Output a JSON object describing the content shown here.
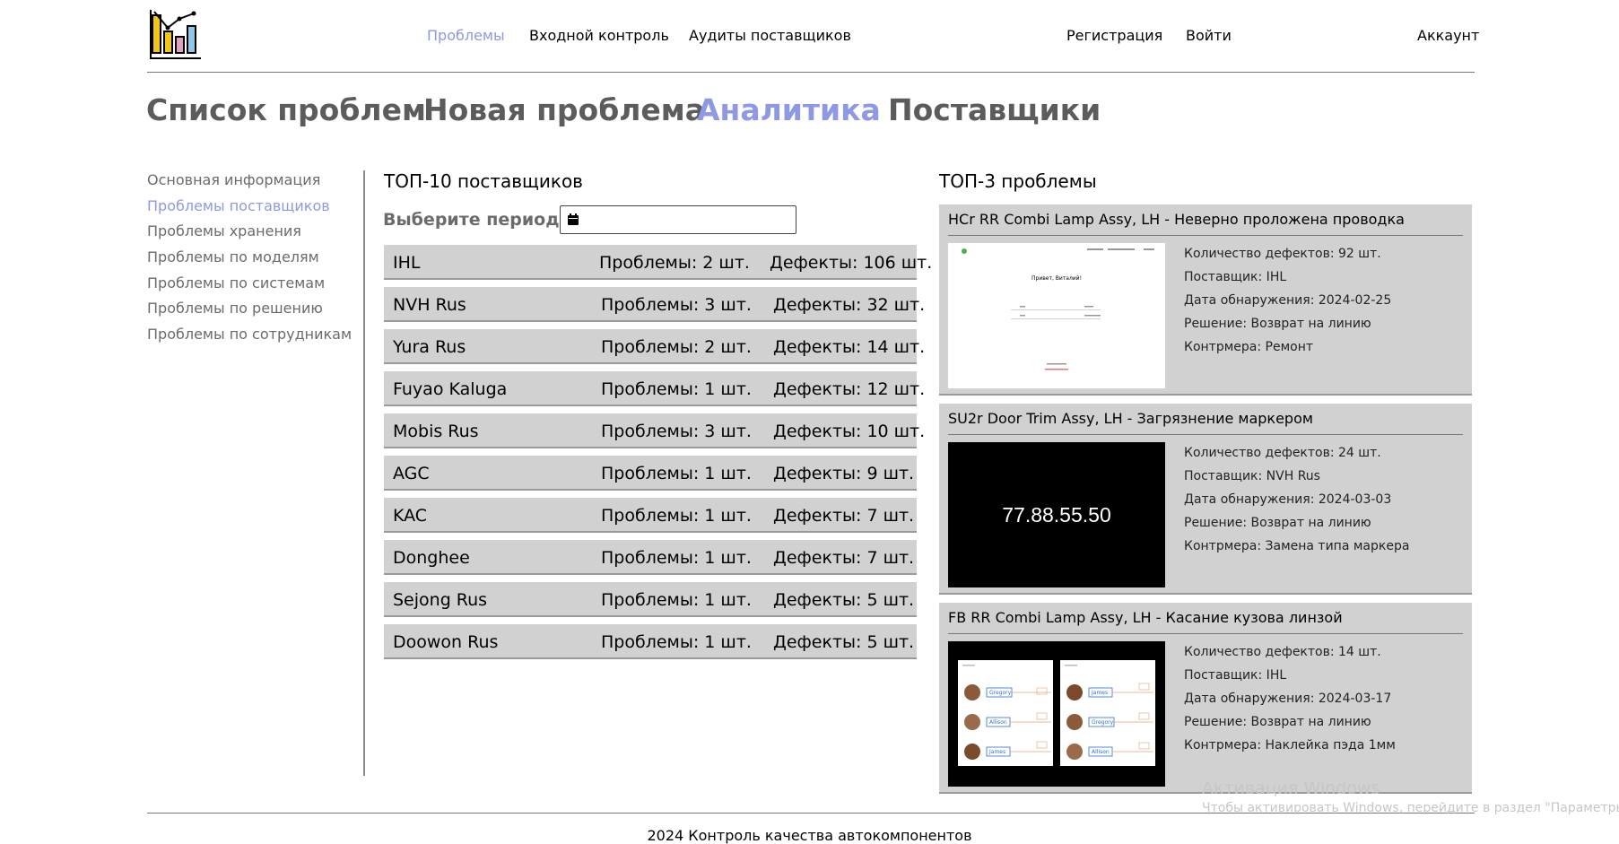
{
  "header": {
    "nav": [
      {
        "label": "Проблемы",
        "active": true
      },
      {
        "label": "Входной контроль",
        "active": false
      },
      {
        "label": "Аудиты поставщиков",
        "active": false
      }
    ],
    "register": "Регистрация",
    "login": "Войти",
    "account": "Аккаунт"
  },
  "tabs": [
    {
      "label": "Список проблем",
      "active": false
    },
    {
      "label": "Новая проблема",
      "active": false
    },
    {
      "label": "Аналитика",
      "active": true
    },
    {
      "label": "Поставщики",
      "active": false
    }
  ],
  "sidebar": {
    "items": [
      {
        "label": "Основная информация",
        "active": false
      },
      {
        "label": "Проблемы поставщиков",
        "active": true
      },
      {
        "label": "Проблемы хранения",
        "active": false
      },
      {
        "label": "Проблемы по моделям",
        "active": false
      },
      {
        "label": "Проблемы по системам",
        "active": false
      },
      {
        "label": "Проблемы по решению",
        "active": false
      },
      {
        "label": "Проблемы по сотрудникам",
        "active": false
      }
    ]
  },
  "top10": {
    "title": "ТОП-10 поставщиков",
    "period_label": "Выберите период",
    "period_value": "",
    "rows": [
      {
        "name": "IHL",
        "problems": "Проблемы: 2 шт.",
        "defects": "Дефекты: 106 шт."
      },
      {
        "name": "NVH Rus",
        "problems": "Проблемы: 3 шт.",
        "defects": "Дефекты: 32 шт."
      },
      {
        "name": "Yura Rus",
        "problems": "Проблемы: 2 шт.",
        "defects": "Дефекты: 14 шт."
      },
      {
        "name": "Fuyao Kaluga",
        "problems": "Проблемы: 1 шт.",
        "defects": "Дефекты: 12 шт."
      },
      {
        "name": "Mobis Rus",
        "problems": "Проблемы: 3 шт.",
        "defects": "Дефекты: 10 шт."
      },
      {
        "name": "AGC",
        "problems": "Проблемы: 1 шт.",
        "defects": "Дефекты: 9 шт."
      },
      {
        "name": "KAC",
        "problems": "Проблемы: 1 шт.",
        "defects": "Дефекты: 7 шт."
      },
      {
        "name": "Donghee",
        "problems": "Проблемы: 1 шт.",
        "defects": "Дефекты: 7 шт."
      },
      {
        "name": "Sejong Rus",
        "problems": "Проблемы: 1 шт.",
        "defects": "Дефекты: 5 шт."
      },
      {
        "name": "Doowon Rus",
        "problems": "Проблемы: 1 шт.",
        "defects": "Дефекты: 5 шт."
      }
    ]
  },
  "top3": {
    "title": "ТОП-3 проблемы",
    "cards": [
      {
        "title": "HCr RR Combi Lamp Assy, LH - Неверно проложена проводка",
        "defects": "Количество дефектов: 92 шт.",
        "supplier": "Поставщик: IHL",
        "date": "Дата обнаружения: 2024-02-25",
        "solution": "Решение: Возврат на линию",
        "countermeasure": "Контрмера: Ремонт",
        "image": {
          "greeting": "Привет, Виталий!"
        }
      },
      {
        "title": "SU2r Door Trim Assy, LH - Загрязнение маркером",
        "defects": "Количество дефектов: 24 шт.",
        "supplier": "Поставщик: NVH Rus",
        "date": "Дата обнаружения: 2024-03-03",
        "solution": "Решение: Возврат на линию",
        "countermeasure": "Контрмера: Замена типа маркера",
        "image": {
          "text": "77.88.55.50"
        }
      },
      {
        "title": "FB RR Combi Lamp Assy, LH - Касание кузова линзой",
        "defects": "Количество дефектов: 14 шт.",
        "supplier": "Поставщик: IHL",
        "date": "Дата обнаружения: 2024-03-17",
        "solution": "Решение: Возврат на линию",
        "countermeasure": "Контрмера: Наклейка пэда 1мм",
        "image": {
          "names_left": [
            "Gregory",
            "Allison",
            "James"
          ],
          "names_right": [
            "James",
            "Gregory",
            "Allison"
          ]
        }
      }
    ]
  },
  "footer": "2024 Контроль качества автокомпонентов",
  "watermark": {
    "line1": "Активация Windows",
    "line2": "Чтобы активировать Windows, перейдите в раздел \"Параметры\"."
  },
  "colors": {
    "accent": "#8f98e3",
    "row_bg": "#d1d1d1",
    "tab_gray": "#5c5c5c"
  }
}
